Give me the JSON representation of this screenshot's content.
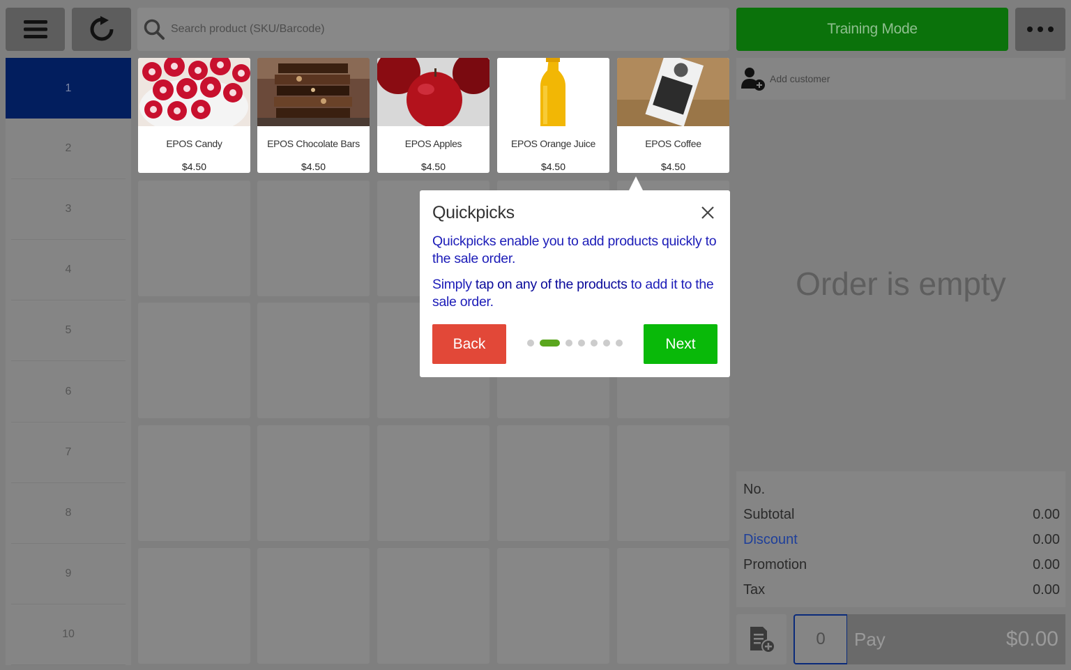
{
  "top_bar": {
    "search_placeholder": "Search product (SKU/Barcode)",
    "training_label": "Training Mode",
    "menu_icon": "hamburger-menu-icon",
    "refresh_icon": "refresh-icon",
    "more_icon": "more-horizontal-icon"
  },
  "pages": [
    "1",
    "2",
    "3",
    "4",
    "5",
    "6",
    "7",
    "8",
    "9",
    "10"
  ],
  "active_page": "1",
  "products": [
    {
      "name": "EPOS Candy",
      "price": "$4.50"
    },
    {
      "name": "EPOS Chocolate Bars",
      "price": "$4.50"
    },
    {
      "name": "EPOS Apples",
      "price": "$4.50"
    },
    {
      "name": "EPOS Orange Juice",
      "price": "$4.50"
    },
    {
      "name": "EPOS Coffee",
      "price": "$4.50"
    }
  ],
  "customer": {
    "label": "Add customer"
  },
  "order": {
    "empty_text": "Order is empty",
    "summary": {
      "no_label": "No.",
      "subtotal_label": "Subtotal",
      "subtotal_value": "0.00",
      "discount_label": "Discount",
      "discount_value": "0.00",
      "promotion_label": "Promotion",
      "promotion_value": "0.00",
      "tax_label": "Tax",
      "tax_value": "0.00"
    },
    "quantity": "0",
    "pay_label": "Pay",
    "pay_total": "$0.00"
  },
  "popup": {
    "title": "Quickpicks",
    "text1": "Quickpicks enable you to add products quickly to the sale order.",
    "text2_before": "Simply ",
    "text2_bold": "tap on any of the products",
    "text2_after": " to add it to the sale order.",
    "back_label": "Back",
    "next_label": "Next",
    "step_total": 7,
    "step_current": 2
  },
  "colors": {
    "accent_green": "#09b909",
    "back_red": "#e24838",
    "active_page_bg": "#021e5e",
    "popup_text": "#1c1cb8"
  }
}
